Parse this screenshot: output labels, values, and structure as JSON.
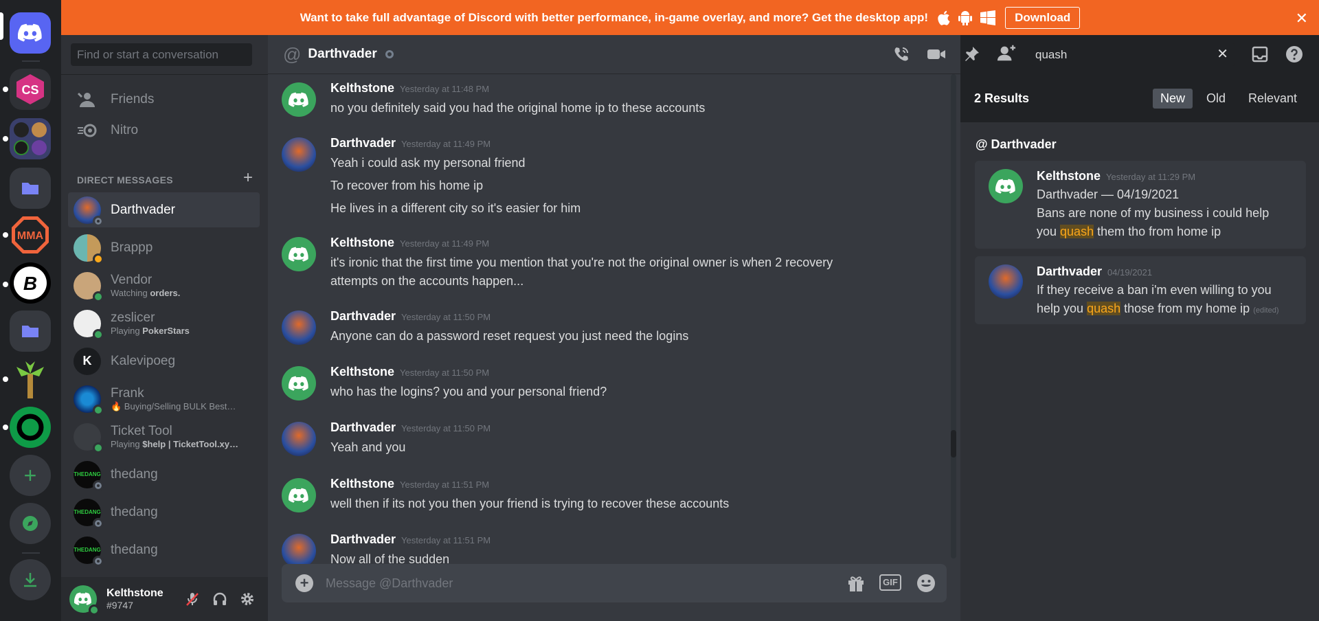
{
  "banner": {
    "text": "Want to take full advantage of Discord with better performance, in-game overlay, and more? Get the desktop app!",
    "download_label": "Download",
    "close_glyph": "✕"
  },
  "rail": {
    "servers": [
      "discord-home",
      "cs-server",
      "mixed-folder",
      "folder",
      "mma-server",
      "b-server",
      "folder-2",
      "palm-server",
      "green-ring-server",
      "add-server",
      "explore",
      "download-apps"
    ],
    "server_initials": {
      "cs": "CS",
      "mma": "MMA",
      "b": "B"
    }
  },
  "dm": {
    "search_placeholder": "Find or start a conversation",
    "nav": [
      {
        "label": "Friends",
        "icon": "friends-icon"
      },
      {
        "label": "Nitro",
        "icon": "nitro-icon"
      }
    ],
    "section_label": "DIRECT MESSAGES",
    "items": [
      {
        "name": "Darthvader",
        "sub": "",
        "status": "offline"
      },
      {
        "name": "Brappp",
        "sub": "",
        "status": "idle"
      },
      {
        "name": "Vendor",
        "sub": "Watching ",
        "sub_bold": "orders.",
        "status": "online"
      },
      {
        "name": "zeslicer",
        "sub": "Playing ",
        "sub_bold": "PokerStars",
        "status": "online"
      },
      {
        "name": "Kalevipoeg",
        "sub": "",
        "status": "none"
      },
      {
        "name": "Frank",
        "sub": "🔥 Buying/Selling BULK Best…",
        "sub_bold": "",
        "status": "online"
      },
      {
        "name": "Ticket Tool",
        "sub": "Playing ",
        "sub_bold": "$help | TicketTool.xy…",
        "status": "online"
      },
      {
        "name": "thedang",
        "sub": "",
        "status": "offline"
      },
      {
        "name": "thedang",
        "sub": "",
        "status": "offline"
      },
      {
        "name": "thedang",
        "sub": "",
        "status": "offline"
      }
    ],
    "avatar_texts": {
      "kalevipoeg": "K",
      "thedang": "THEDANG"
    }
  },
  "user": {
    "name": "Kelthstone",
    "tag": "#9747"
  },
  "chat": {
    "at": "@",
    "title": "Darthvader",
    "composer_placeholder": "Message @Darthvader",
    "composer_gif": "GIF",
    "messages": [
      {
        "author": "Kelthstone",
        "time": "Yesterday at 11:48 PM",
        "lines": [
          "no you definitely said you had the original home ip to these accounts"
        ]
      },
      {
        "author": "Darthvader",
        "time": "Yesterday at 11:49 PM",
        "lines": [
          "Yeah i could ask my personal friend",
          "To recover from his home ip",
          "He lives in a different city so it's easier for him"
        ]
      },
      {
        "author": "Kelthstone",
        "time": "Yesterday at 11:49 PM",
        "lines": [
          "it's ironic that the first time you mention that you're not the original owner is when 2 recovery",
          "attempts on the accounts happen..."
        ]
      },
      {
        "author": "Darthvader",
        "time": "Yesterday at 11:50 PM",
        "lines": [
          "Anyone can do a password reset request you just need the logins"
        ]
      },
      {
        "author": "Kelthstone",
        "time": "Yesterday at 11:50 PM",
        "lines": [
          "who has the logins? you and your personal friend?"
        ]
      },
      {
        "author": "Darthvader",
        "time": "Yesterday at 11:50 PM",
        "lines": [
          "Yeah and you"
        ]
      },
      {
        "author": "Kelthstone",
        "time": "Yesterday at 11:51 PM",
        "lines": [
          "well then if its not you then your friend is trying to recover these accounts"
        ]
      },
      {
        "author": "Darthvader",
        "time": "Yesterday at 11:51 PM",
        "lines": [
          "Now all of the sudden"
        ]
      }
    ]
  },
  "search": {
    "query": "quash",
    "result_count": "2 Results",
    "sort": [
      "New",
      "Old",
      "Relevant"
    ],
    "sort_active": "New",
    "channel": "@ Darthvader",
    "results": [
      {
        "author": "Kelthstone",
        "time": "Yesterday at 11:29 PM",
        "line1": "Darthvader — 04/19/2021",
        "line2": "Bans are none of my business i could help",
        "pre": "you ",
        "hit": "quash",
        "post": " them tho from home ip",
        "edited": ""
      },
      {
        "author": "Darthvader",
        "time": "04/19/2021",
        "line1": "If they receive a ban i'm even willing to you",
        "line2": "",
        "pre": "help you ",
        "hit": "quash",
        "post": " those from my home ip",
        "edited": "(edited)"
      }
    ]
  },
  "colors": {
    "blurple": "#5865f2",
    "green": "#3ba55d",
    "orange": "#f26522",
    "bg": "#36393f"
  }
}
